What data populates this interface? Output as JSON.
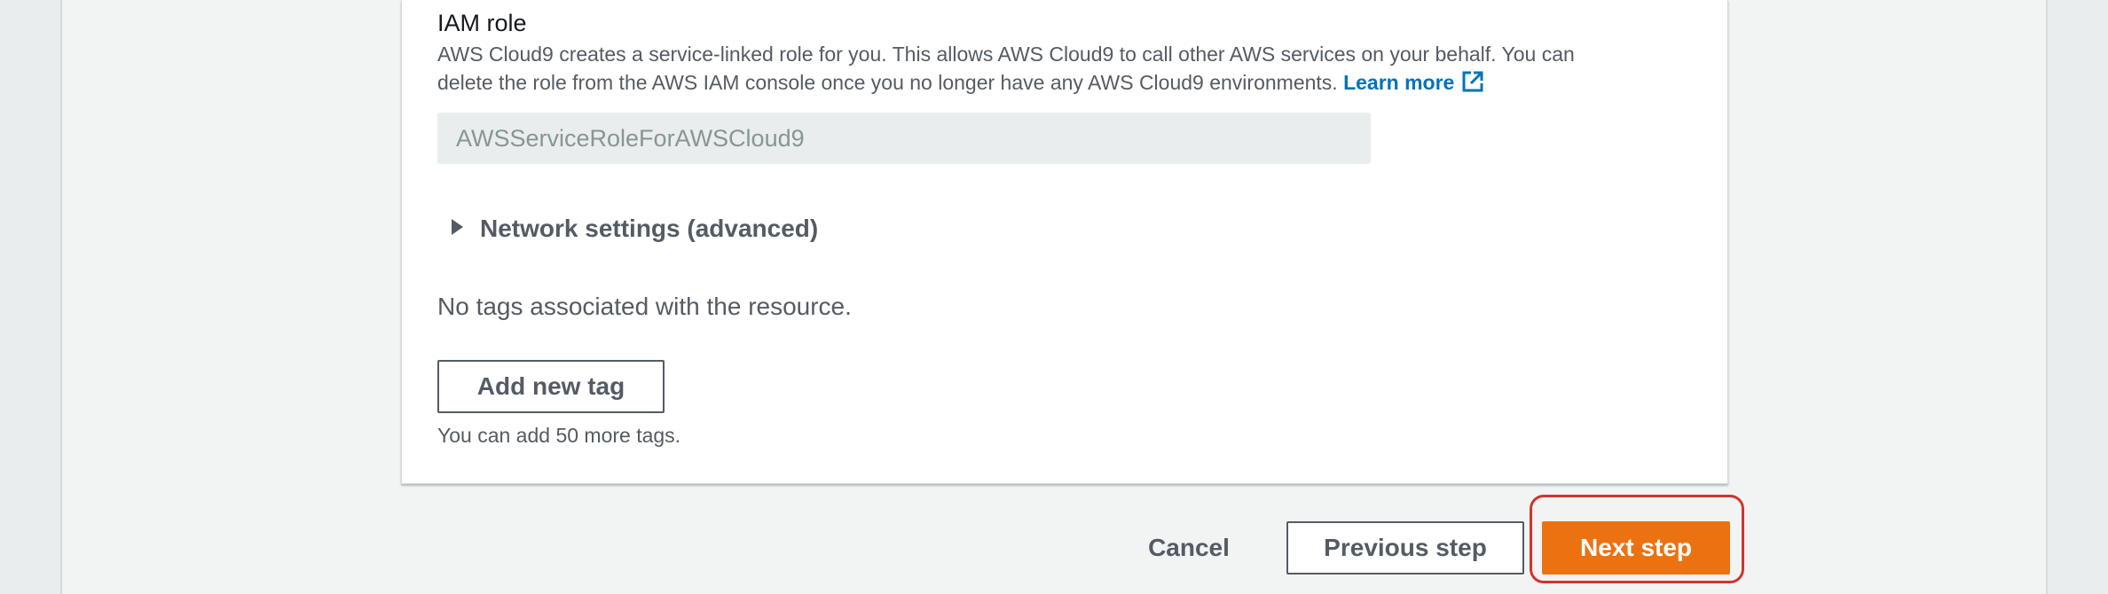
{
  "iam": {
    "title": "IAM role",
    "description": "AWS Cloud9 creates a service-linked role for you. This allows AWS Cloud9 to call other AWS services on your behalf. You can delete the role from the AWS IAM console once you no longer have any AWS Cloud9 environments.",
    "learn_more": "Learn more",
    "learn_more_icon": "external-link-icon",
    "role_value": "AWSServiceRoleForAWSCloud9"
  },
  "network": {
    "label": "Network settings (advanced)",
    "icon": "caret-right-icon"
  },
  "tags": {
    "empty_message": "No tags associated with the resource.",
    "add_button": "Add new tag",
    "hint": "You can add 50 more tags."
  },
  "footer": {
    "cancel": "Cancel",
    "previous": "Previous step",
    "next": "Next step"
  },
  "colors": {
    "primary": "#ec7211",
    "link": "#0073bb",
    "highlight": "#d0342c"
  }
}
